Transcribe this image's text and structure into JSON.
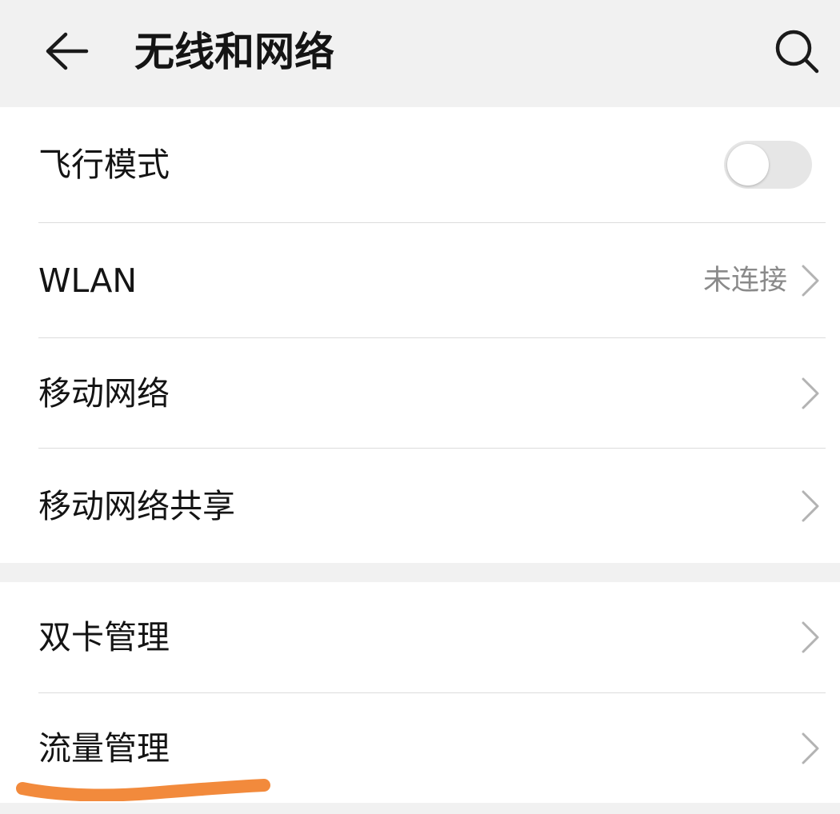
{
  "header": {
    "title": "无线和网络",
    "back_icon": "arrow-left-icon",
    "search_icon": "search-icon"
  },
  "settings": {
    "airplane_mode": {
      "label": "飞行模式",
      "enabled": false
    },
    "wlan": {
      "label": "WLAN",
      "status": "未连接"
    },
    "mobile_network": {
      "label": "移动网络"
    },
    "tethering": {
      "label": "移动网络共享"
    },
    "dual_sim": {
      "label": "双卡管理"
    },
    "data_usage": {
      "label": "流量管理"
    }
  },
  "annotation": {
    "underline_color": "#f28a3c"
  },
  "colors": {
    "background": "#f1f1f1",
    "card": "#ffffff",
    "text_primary": "#141414",
    "text_secondary": "#8a8a8a",
    "divider": "#dcdcdc",
    "toggle_off": "#e6e6e6"
  }
}
